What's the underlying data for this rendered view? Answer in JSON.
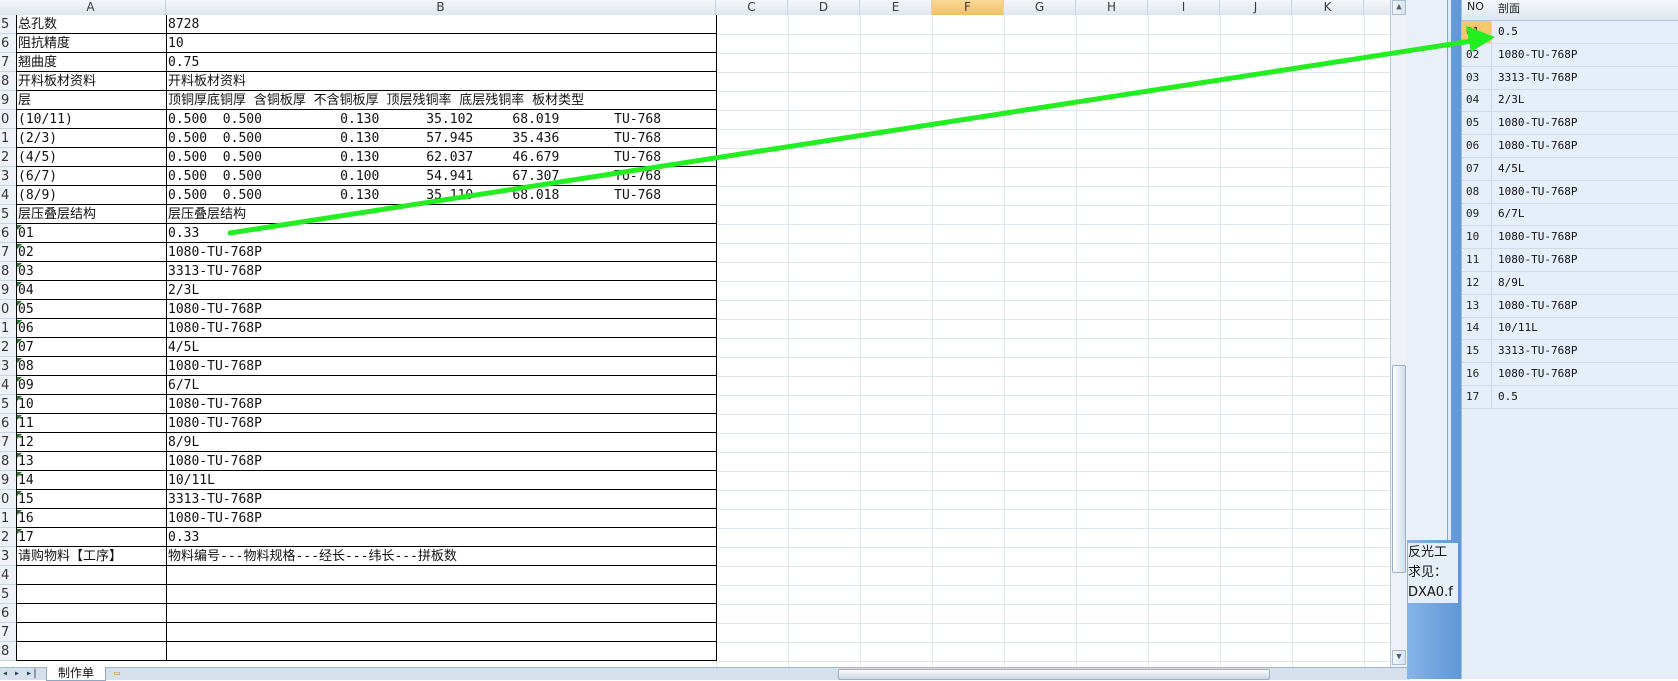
{
  "columns": [
    "A",
    "B",
    "C",
    "D",
    "E",
    "F",
    "G",
    "H",
    "I",
    "J",
    "K"
  ],
  "selected_column": "F",
  "rows": [
    {
      "num": "5",
      "a": "总孔数",
      "b": "8728"
    },
    {
      "num": "6",
      "a": "阻抗精度",
      "b": "10"
    },
    {
      "num": "7",
      "a": "翘曲度",
      "b": "0.75"
    },
    {
      "num": "8",
      "a": "开料板材资料",
      "b": "开料板材资料"
    },
    {
      "num": "9",
      "a": "层",
      "b": "顶铜厚底铜厚 含铜板厚 不含铜板厚 顶层残铜率 底层残铜率 板材类型"
    },
    {
      "num": "0",
      "a": "(10/11)",
      "b": "0.500  0.500          0.130      35.102     68.019       TU-768"
    },
    {
      "num": "1",
      "a": "(2/3)",
      "b": "0.500  0.500          0.130      57.945     35.436       TU-768"
    },
    {
      "num": "2",
      "a": "(4/5)",
      "b": "0.500  0.500          0.130      62.037     46.679       TU-768"
    },
    {
      "num": "3",
      "a": "(6/7)",
      "b": "0.500  0.500          0.100      54.941     67.307       TU-768"
    },
    {
      "num": "4",
      "a": "(8/9)",
      "b": "0.500  0.500          0.130      35.110     68.018       TU-768"
    },
    {
      "num": "5",
      "a": "层压叠层结构",
      "b": "层压叠层结构"
    },
    {
      "num": "6",
      "a": "01",
      "b": "0.33"
    },
    {
      "num": "7",
      "a": "02",
      "b": "1080-TU-768P"
    },
    {
      "num": "8",
      "a": "03",
      "b": "3313-TU-768P"
    },
    {
      "num": "9",
      "a": "04",
      "b": "2/3L"
    },
    {
      "num": "0",
      "a": "05",
      "b": "1080-TU-768P"
    },
    {
      "num": "1",
      "a": "06",
      "b": "1080-TU-768P"
    },
    {
      "num": "2",
      "a": "07",
      "b": "4/5L"
    },
    {
      "num": "3",
      "a": "08",
      "b": "1080-TU-768P"
    },
    {
      "num": "4",
      "a": "09",
      "b": "6/7L"
    },
    {
      "num": "5",
      "a": "10",
      "b": "1080-TU-768P"
    },
    {
      "num": "6",
      "a": "11",
      "b": "1080-TU-768P"
    },
    {
      "num": "7",
      "a": "12",
      "b": "8/9L"
    },
    {
      "num": "8",
      "a": "13",
      "b": "1080-TU-768P"
    },
    {
      "num": "9",
      "a": "14",
      "b": "10/11L"
    },
    {
      "num": "0",
      "a": "15",
      "b": "3313-TU-768P"
    },
    {
      "num": "1",
      "a": "16",
      "b": "1080-TU-768P"
    },
    {
      "num": "2",
      "a": "17",
      "b": "0.33"
    },
    {
      "num": "3",
      "a": "请购物料【工序】",
      "b": "物料编号---物料规格---经长---纬长---拼板数"
    },
    {
      "num": "4",
      "a": "",
      "b": ""
    },
    {
      "num": "5",
      "a": "",
      "b": ""
    },
    {
      "num": "6",
      "a": "",
      "b": ""
    },
    {
      "num": "7",
      "a": "",
      "b": ""
    },
    {
      "num": "8",
      "a": "",
      "b": ""
    }
  ],
  "sheet_tab": "制作单",
  "side_texts": [
    "反光工",
    "求见：",
    "DXA0.f"
  ],
  "right_panel": {
    "headers": [
      "NO",
      "剖面"
    ],
    "rows": [
      {
        "no": "01",
        "val": "0.5"
      },
      {
        "no": "02",
        "val": "1080-TU-768P"
      },
      {
        "no": "03",
        "val": "3313-TU-768P"
      },
      {
        "no": "04",
        "val": "2/3L"
      },
      {
        "no": "05",
        "val": "1080-TU-768P"
      },
      {
        "no": "06",
        "val": "1080-TU-768P"
      },
      {
        "no": "07",
        "val": "4/5L"
      },
      {
        "no": "08",
        "val": "1080-TU-768P"
      },
      {
        "no": "09",
        "val": "6/7L"
      },
      {
        "no": "10",
        "val": "1080-TU-768P"
      },
      {
        "no": "11",
        "val": "1080-TU-768P"
      },
      {
        "no": "12",
        "val": "8/9L"
      },
      {
        "no": "13",
        "val": "1080-TU-768P"
      },
      {
        "no": "14",
        "val": "10/11L"
      },
      {
        "no": "15",
        "val": "3313-TU-768P"
      },
      {
        "no": "16",
        "val": "1080-TU-768P"
      },
      {
        "no": "17",
        "val": "0.5"
      }
    ]
  },
  "colors": {
    "arrow": "#22ee22",
    "selected_header": "#f6c86e",
    "panel_bg": "#e6eefa",
    "window_blue": "#6ea6e0"
  }
}
